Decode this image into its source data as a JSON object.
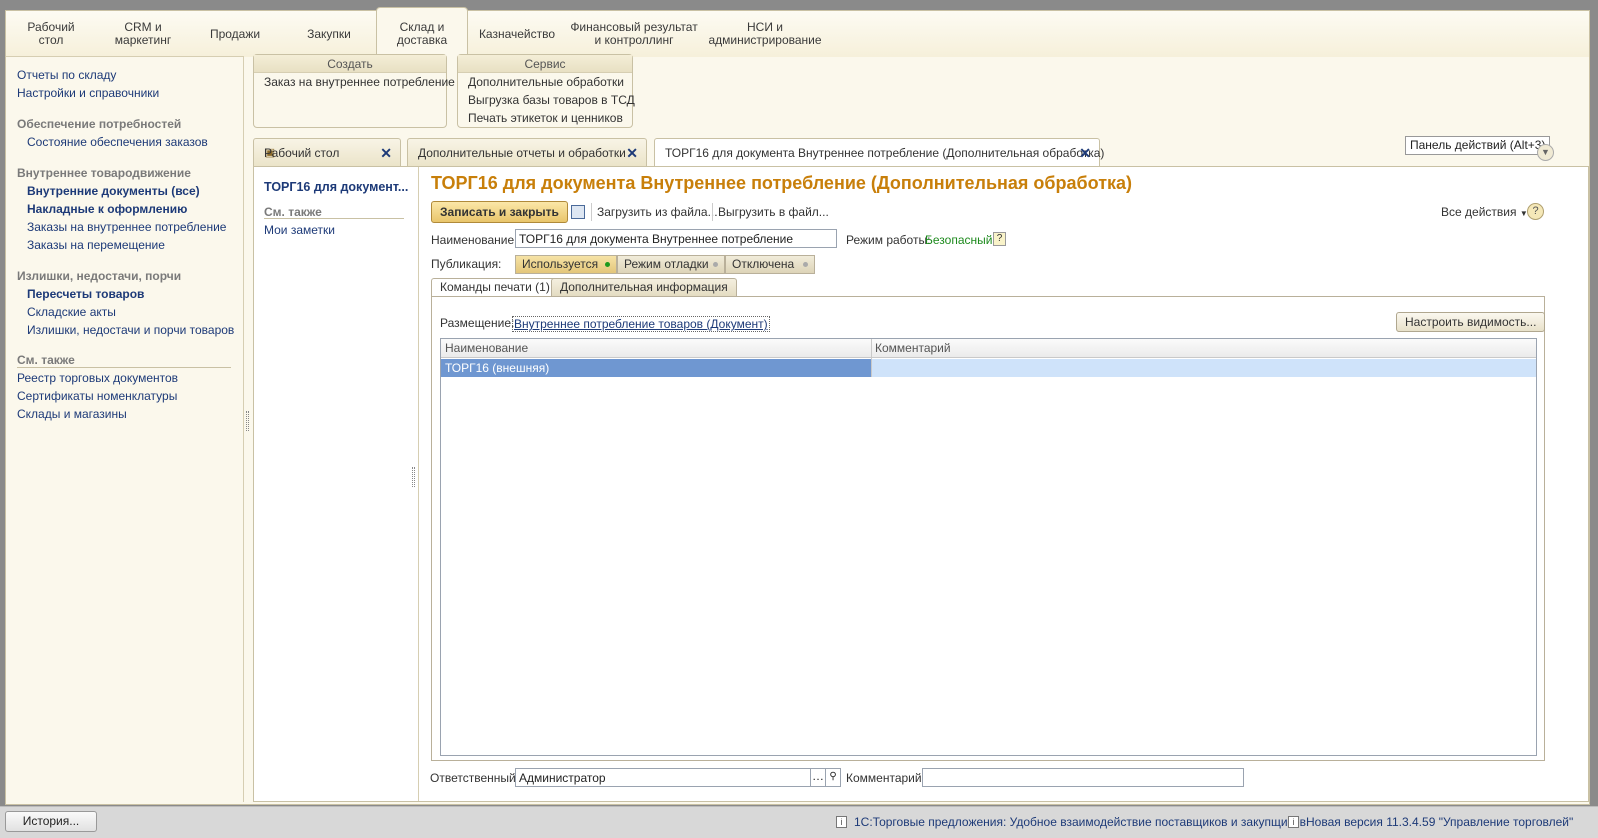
{
  "sections": [
    {
      "label": "Рабочий\nстол"
    },
    {
      "label": "CRM и\nмаркетинг"
    },
    {
      "label": "Продажи"
    },
    {
      "label": "Закупки"
    },
    {
      "label": "Склад и\nдоставка"
    },
    {
      "label": "Казначейство"
    },
    {
      "label": "Финансовый результат\nи контроллинг"
    },
    {
      "label": "НСИ и\nадминистрирование"
    }
  ],
  "leftnav": {
    "links_top": [
      "Отчеты по складу",
      "Настройки и справочники"
    ],
    "group1": "Обеспечение потребностей",
    "group1_items": [
      "Состояние обеспечения заказов"
    ],
    "group2": "Внутреннее товародвижение",
    "group2_items": [
      "Внутренние документы (все)",
      "Накладные к оформлению",
      "Заказы на внутреннее потребление",
      "Заказы на перемещение"
    ],
    "group3": "Излишки, недостачи, порчи",
    "group3_items": [
      "Пересчеты товаров",
      "Складские акты",
      "Излишки, недостачи и порчи товаров"
    ],
    "see_also": "См. также",
    "see_also_items": [
      "Реестр торговых документов",
      "Сертификаты номенклатуры",
      "Склады и магазины"
    ]
  },
  "create_box": {
    "header": "Создать",
    "items": [
      "Заказ на внутреннее потребление"
    ]
  },
  "service_box": {
    "header": "Сервис",
    "items": [
      "Дополнительные обработки",
      "Выгрузка базы товаров в ТСД",
      "Печать этикеток и ценников"
    ]
  },
  "tabs": [
    {
      "label": "Рабочий стол"
    },
    {
      "label": "Дополнительные отчеты и обработки"
    },
    {
      "label": "ТОРГ16 для документа Внутреннее потребление (Дополнительная обработка)"
    }
  ],
  "actions_panel": "Панель действий (Alt+3)",
  "formnav": {
    "current": "ТОРГ16 для документ...",
    "see_also": "См. также",
    "notes": "Мои заметки"
  },
  "form": {
    "title": "ТОРГ16 для документа Внутреннее потребление (Дополнительная обработка)",
    "save_close": "Записать и закрыть",
    "load_file": "Загрузить из файла...",
    "unload_file": "Выгрузить в файл...",
    "all_actions": "Все действия",
    "name_label": "Наименование:",
    "name_value": "ТОРГ16 для документа Внутреннее потребление",
    "mode_label": "Режим работы:",
    "mode_value": "Безопасный",
    "publication_label": "Публикация:",
    "publication_options": [
      "Используется",
      "Режим отладки",
      "Отключена"
    ],
    "inner_tabs": [
      "Команды печати (1)",
      "Дополнительная информация"
    ],
    "placement_label": "Размещение:",
    "placement_value": "Внутреннее потребление товаров (Документ)",
    "configure_visibility": "Настроить видимость...",
    "grid_headers": [
      "Наименование",
      "Комментарий"
    ],
    "grid_rows": [
      {
        "name": "ТОРГ16 (внешняя)",
        "comment": ""
      }
    ],
    "responsible_label": "Ответственный:",
    "responsible_value": "Администратор",
    "comment_label": "Комментарий:",
    "comment_value": ""
  },
  "status": {
    "history": "История...",
    "msg1": "1С:Торговые предложения: Удобное взаимодействие поставщиков и закупщиков",
    "msg2": "Новая версия 11.3.4.59 \"Управление торговлей\""
  },
  "colors": {
    "title_orange": "#c87f0a",
    "link_blue": "#1d3a78",
    "selected_row": "#6f97d1",
    "safe_green": "#1d8a1d"
  }
}
